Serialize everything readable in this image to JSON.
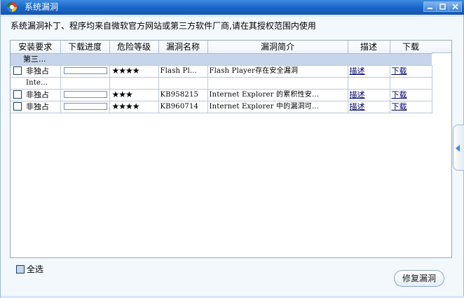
{
  "window": {
    "title": "系统漏洞",
    "icon": "security-shield-icon"
  },
  "info_text": "系统漏洞补丁、程序均来自微软官方网站或第三方软件厂商,请在其授权范围内使用",
  "table": {
    "columns": [
      "安装要求",
      "下载进度",
      "危险等级",
      "漏洞名称",
      "漏洞简介",
      "描述",
      "下载"
    ],
    "group_label": "第三...",
    "rows": [
      {
        "type": "item",
        "requirement": "非独占",
        "progress": 0,
        "risk_stars": "★★★★",
        "name": "Flash Pl...",
        "summary": "Flash Player存在安全漏洞",
        "desc_link": "描述",
        "download_link": "下载"
      },
      {
        "type": "category",
        "label": "Inte..."
      },
      {
        "type": "item",
        "requirement": "非独占",
        "progress": 0,
        "risk_stars": "★★★",
        "name": "KB958215",
        "summary": "Internet Explorer 的累积性安...",
        "desc_link": "描述",
        "download_link": "下载"
      },
      {
        "type": "item",
        "requirement": "非独占",
        "progress": 0,
        "risk_stars": "★★★★",
        "name": "KB960714",
        "summary": "Internet Explorer 中的漏洞可...",
        "desc_link": "描述",
        "download_link": "下载"
      }
    ]
  },
  "select_all_label": "全选",
  "repair_button_label": "修复漏洞",
  "colors": {
    "titlebar": "#1a66c8",
    "group_row": "#c6d5ea",
    "link": "#00006e",
    "progress_fill": "#3bb34a"
  }
}
